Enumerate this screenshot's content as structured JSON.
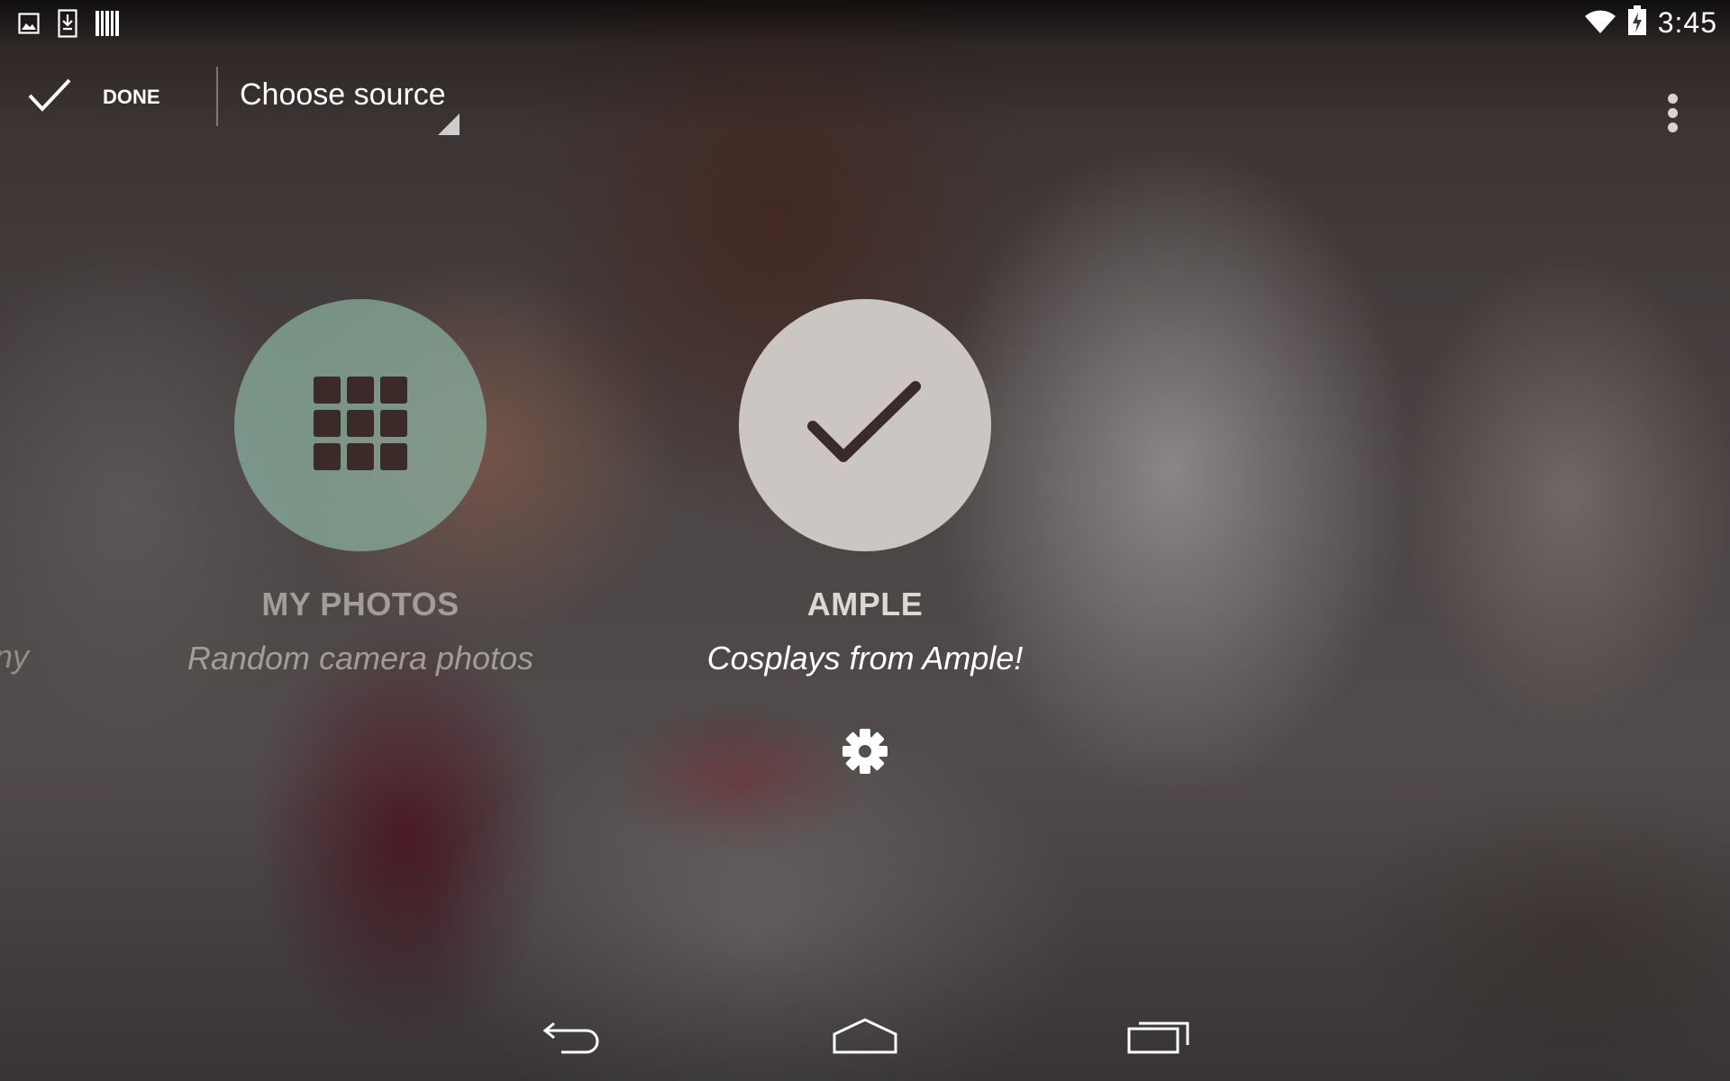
{
  "status_bar": {
    "notification_icons": [
      "image-icon",
      "download-icon",
      "barcode-icon"
    ],
    "system_icons": [
      "wifi-icon",
      "battery-charging-icon"
    ],
    "time": "3:45"
  },
  "action_bar": {
    "done_label": "DONE",
    "spinner_title": "Choose source",
    "overflow_icon": "more-vert-icon"
  },
  "sources": {
    "partial_left_desc": "ny",
    "items": [
      {
        "title": "MY PHOTOS",
        "description": "Random camera photos",
        "icon": "grid-icon",
        "selected": false
      },
      {
        "title": "AMPLE",
        "description": "Cosplays from Ample!",
        "icon": "check-icon",
        "selected": true
      }
    ],
    "settings_icon": "gear-icon"
  },
  "nav_bar": {
    "icons": [
      "back-icon",
      "home-icon",
      "recents-icon"
    ]
  },
  "colors": {
    "my_photos_circle": "#87aa9b",
    "ample_circle": "#cbc6c1",
    "icon_dark": "#3a2a28"
  }
}
